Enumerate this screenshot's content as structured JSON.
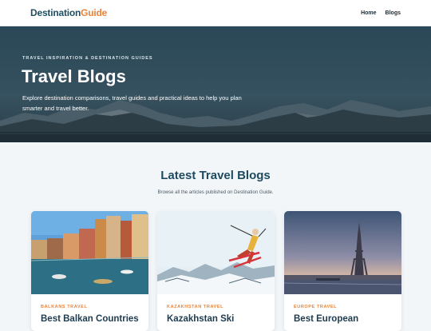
{
  "nav": {
    "logo_part1": "Destination",
    "logo_part2": "Guide",
    "links": [
      "Home",
      "Blogs"
    ]
  },
  "hero": {
    "eyebrow": "TRAVEL INSPIRATION & DESTINATION GUIDES",
    "title": "Travel Blogs",
    "subtitle": "Explore destination comparisons, travel guides and practical ideas to help you plan smarter and travel better."
  },
  "section": {
    "title": "Latest Travel Blogs",
    "subtitle": "Browse all the articles published on Destination Guide."
  },
  "cards": [
    {
      "category": "BALKANS TRAVEL",
      "title": "Best Balkan Countries"
    },
    {
      "category": "KAZAKHSTAN TRAVEL",
      "title": "Kazakhstan Ski"
    },
    {
      "category": "EUROPE TRAVEL",
      "title": "Best European"
    }
  ],
  "colors": {
    "accent": "#e8833a",
    "brand": "#1f4e63"
  }
}
